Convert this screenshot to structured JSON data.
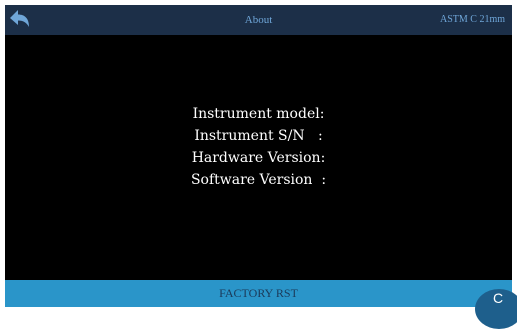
{
  "header": {
    "title": "About",
    "standard": "ASTM C 21mm",
    "back_icon": "back-arrow-icon"
  },
  "info": {
    "instrument_model_label": "Instrument model:",
    "instrument_sn_label": "Instrument S/N   :",
    "hardware_version_label": "Hardware Version:",
    "software_version_label": "Software Version  :"
  },
  "footer": {
    "factory_reset_label": "FACTORY RST"
  },
  "corner": {
    "glyph": "C"
  },
  "colors": {
    "screen_bg": "#000000",
    "topbar_bg": "#1c2f48",
    "topbar_text": "#6fa6d8",
    "footer_bg": "#2a95c9",
    "footer_text": "#1b3a5a"
  }
}
